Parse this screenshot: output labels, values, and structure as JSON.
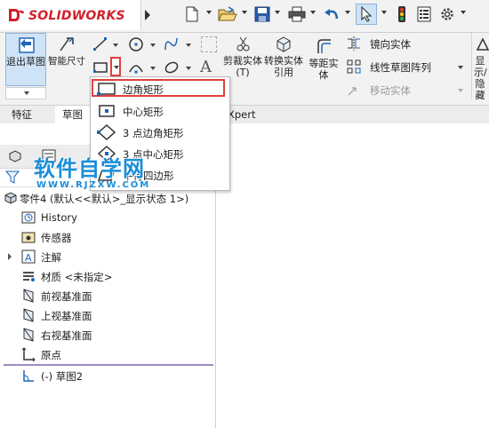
{
  "app": {
    "brand": "SOLIDWORKS"
  },
  "ribbon": {
    "exit_sketch": "退出草图",
    "smart_dimension": "智能尺寸",
    "trim_entities": "剪裁实体(T)",
    "convert_entities": "转换实体引用",
    "offset_entities": "等距实体",
    "mirror_entities": "镜向实体",
    "linear_pattern": "线性草图阵列",
    "move_entities": "移动实体",
    "display_hide": "显示/隐藏关系"
  },
  "tabs": {
    "features": "特征",
    "sketch": "草图",
    "xpert": "Xpert"
  },
  "rect_menu": {
    "items": [
      {
        "label": "边角矩形",
        "icon": "corner-rectangle-icon"
      },
      {
        "label": "中心矩形",
        "icon": "center-rectangle-icon"
      },
      {
        "label": "3 点边角矩形",
        "icon": "3point-corner-rectangle-icon"
      },
      {
        "label": "3 点中心矩形",
        "icon": "3point-center-rectangle-icon"
      },
      {
        "label": "平行四边形",
        "icon": "parallelogram-icon"
      }
    ]
  },
  "watermark": {
    "title": "软件自学网",
    "url": "WWW.RJZXW.COM"
  },
  "tree": {
    "root": "零件4 (默认<<默认>_显示状态 1>)",
    "items": [
      {
        "label": "History",
        "icon": "history-icon"
      },
      {
        "label": "传感器",
        "icon": "sensor-icon"
      },
      {
        "label": "注解",
        "icon": "annotation-icon"
      },
      {
        "label": "材质 <未指定>",
        "icon": "material-icon"
      },
      {
        "label": "前视基准面",
        "icon": "plane-icon"
      },
      {
        "label": "上视基准面",
        "icon": "plane-icon"
      },
      {
        "label": "右视基准面",
        "icon": "plane-icon"
      },
      {
        "label": "原点",
        "icon": "origin-icon"
      },
      {
        "label": "(-) 草图2",
        "icon": "sketch-icon"
      }
    ]
  },
  "colors": {
    "highlight_border": "#e0403c",
    "brand_red": "#d0202a",
    "watermark_blue": "#1a8ed8"
  }
}
